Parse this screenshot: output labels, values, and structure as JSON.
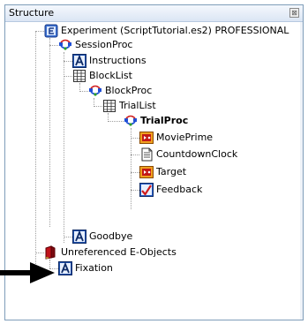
{
  "panel": {
    "title": "Structure",
    "close_glyph": "⊠"
  },
  "tree": {
    "experiment": "Experiment (ScriptTutorial.es2) PROFESSIONAL",
    "sessionproc": "SessionProc",
    "instructions": "Instructions",
    "blocklist": "BlockList",
    "blockproc": "BlockProc",
    "triallist": "TrialList",
    "trialproc": "TrialProc",
    "movieprime": "MoviePrime",
    "countdownclock": "CountdownClock",
    "target": "Target",
    "feedback": "Feedback",
    "goodbye": "Goodbye",
    "unreferenced": "Unreferenced E-Objects",
    "fixation": "Fixation"
  },
  "icons": {
    "experiment": "experiment-icon",
    "procedure": "procedure-icon",
    "textdisplay": "text-display-icon",
    "list": "list-icon",
    "moviedisplay": "movie-display-icon",
    "inline": "inline-script-icon",
    "feedbackdisplay": "feedback-display-icon",
    "unreferenced": "unreferenced-folder-icon",
    "pointer": "pointer-arrow-icon"
  }
}
